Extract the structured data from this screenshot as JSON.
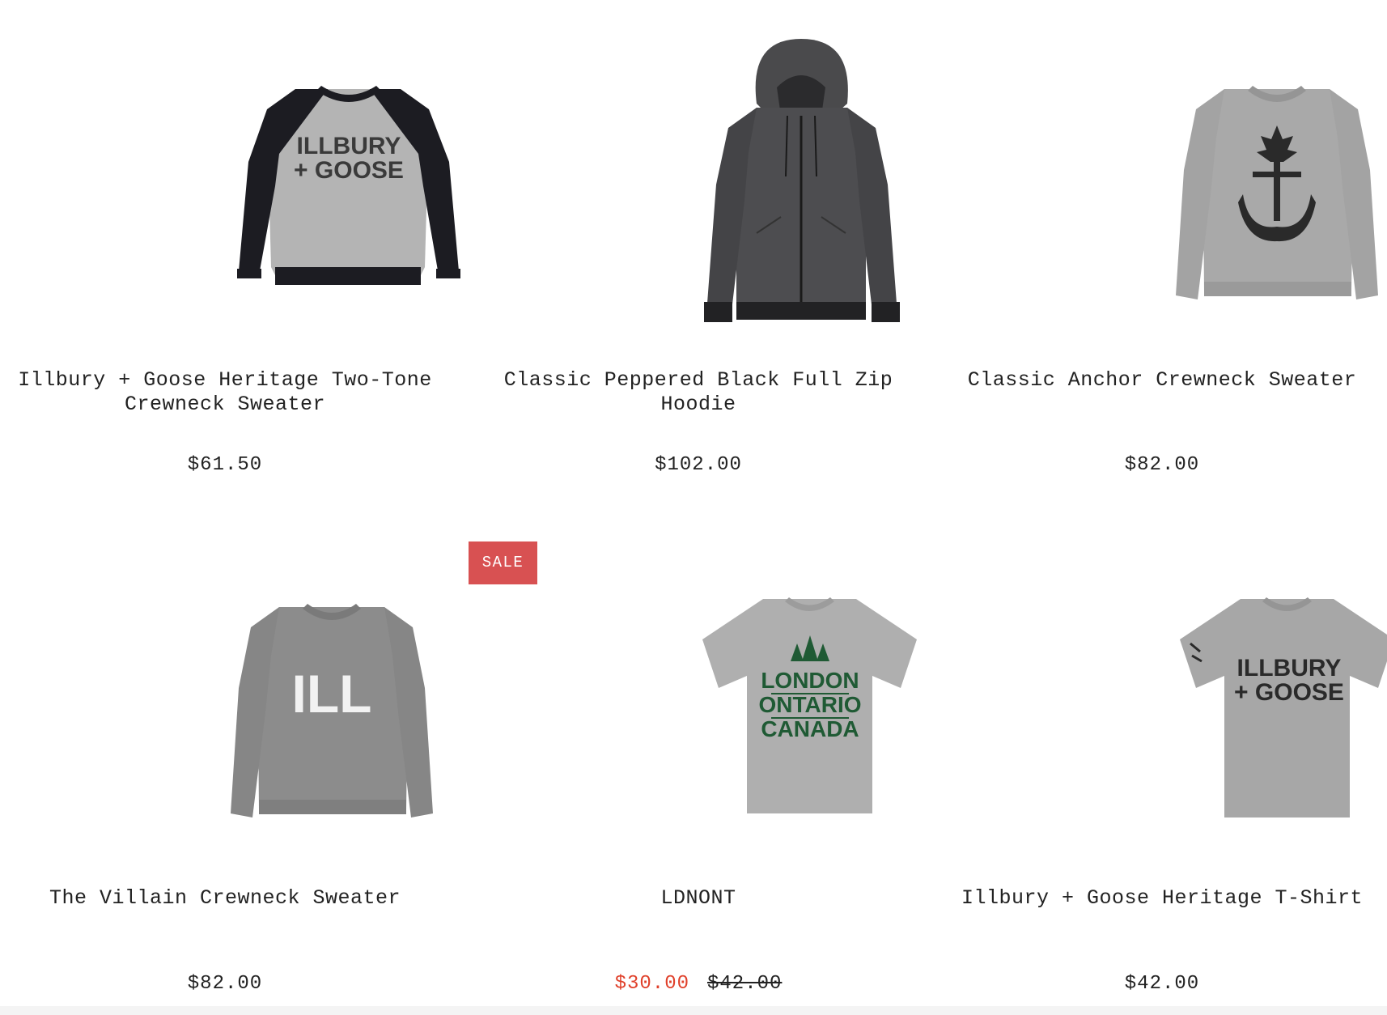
{
  "products": [
    {
      "title": "Illbury + Goose Heritage Two-Tone Crewneck Sweater",
      "price": "$61.50",
      "image": {
        "icon": "two-tone-raglan-sweater",
        "print_line1": "ILLBURY",
        "print_line2": "+ GOOSE"
      }
    },
    {
      "title": "Classic Peppered Black Full Zip Hoodie",
      "price": "$102.00",
      "image": {
        "icon": "zip-hoodie"
      }
    },
    {
      "title": "Classic Anchor Crewneck Sweater",
      "price": "$82.00",
      "image": {
        "icon": "anchor-sweater"
      }
    },
    {
      "title": "The Villain Crewneck Sweater",
      "price": "$82.00",
      "image": {
        "icon": "ill-sweater",
        "print_line1": "ILL"
      }
    },
    {
      "title": "LDNONT",
      "badge": "SALE",
      "sale_price": "$30.00",
      "original_price": "$42.00",
      "image": {
        "icon": "london-ontario-tshirt",
        "print_line1": "LONDON",
        "print_line2": "ONTARIO",
        "print_line3": "CANADA"
      }
    },
    {
      "title": "Illbury + Goose Heritage T-Shirt",
      "price": "$42.00",
      "image": {
        "icon": "heritage-tshirt",
        "print_line1": "ILLBURY",
        "print_line2": "+ GOOSE"
      }
    }
  ],
  "colors": {
    "sale_badge": "#d85152",
    "sale_price": "#e0402a",
    "heather_grey": "#a9a9a9",
    "black_sleeve": "#1c1c22",
    "tree_green": "#1f5a34"
  }
}
